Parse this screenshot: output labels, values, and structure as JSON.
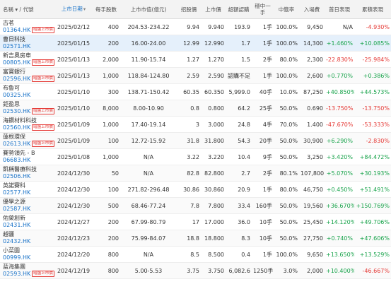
{
  "columns": {
    "name": "名稱 ▾ / 代號",
    "list_date": "上市日期",
    "lot": "每手股數",
    "mcap": "上市市值(億元)",
    "offer_price": "招股價",
    "list_price": "上市價",
    "oversub": "超額認購",
    "win_lot": "穩中一手",
    "win_rate": "中籤率",
    "entry_fee": "入場費",
    "day1": "首日表現",
    "cumulative": "累積表現"
  },
  "sorted_column": "list_date",
  "rows": [
    {
      "name": "古茗",
      "code": "01364.HK",
      "badge": "暗盤上市價",
      "date": "2025/02/12",
      "lot": "400",
      "mcap": "204.53-234.22",
      "offer": "9.94",
      "list": "9.940",
      "oversub": "193.9",
      "win": "1手",
      "rate": "100.0%",
      "fee": "9,450",
      "day1": "N/A",
      "cum": "-4.930%",
      "highlight": false
    },
    {
      "name": "曹日科技",
      "code": "02571.HK",
      "badge": "",
      "date": "2025/01/15",
      "lot": "200",
      "mcap": "16.00-24.00",
      "offer": "12.99",
      "list": "12.990",
      "oversub": "1.7",
      "win": "1手",
      "rate": "100.0%",
      "fee": "14,300",
      "day1": "+1.460%",
      "cum": "+10.085%",
      "highlight": true
    },
    {
      "name": "新吉奧房車",
      "code": "00805.HK",
      "badge": "暗盤上市價",
      "date": "2025/01/13",
      "lot": "2,000",
      "mcap": "11.90-15.74",
      "offer": "1.27",
      "list": "1.270",
      "oversub": "1.5",
      "win": "2手",
      "rate": "80.0%",
      "fee": "2,300",
      "day1": "-22.830%",
      "cum": "-25.984%",
      "highlight": false
    },
    {
      "name": "富寶銀行",
      "code": "02596.HK",
      "badge": "暗盤上市價",
      "date": "2025/01/13",
      "lot": "1,000",
      "mcap": "118.84-124.80",
      "offer": "2.59",
      "list": "2.590",
      "oversub": "認購不足",
      "win": "1手",
      "rate": "100.0%",
      "fee": "2,600",
      "day1": "+0.770%",
      "cum": "+0.386%",
      "highlight": false
    },
    {
      "name": "布魯可",
      "code": "00325.HK",
      "badge": "",
      "date": "2025/01/10",
      "lot": "300",
      "mcap": "138.71-150.42",
      "offer": "60.35",
      "list": "60.350",
      "oversub": "5,999.0",
      "win": "40手",
      "rate": "10.0%",
      "fee": "87,250",
      "day1": "+40.850%",
      "cum": "+44.573%",
      "highlight": false
    },
    {
      "name": "鉅盈思",
      "code": "02530.HK",
      "badge": "暗盤上市價",
      "date": "2025/01/10",
      "lot": "8,000",
      "mcap": "8.00-10.90",
      "offer": "0.8",
      "list": "0.800",
      "oversub": "64.2",
      "win": "25手",
      "rate": "50.0%",
      "fee": "0.690",
      "day1": "-13.750%",
      "cum": "-13.750%",
      "highlight": false
    },
    {
      "name": "海鑽材料科技",
      "code": "02560.HK",
      "badge": "暗盤上市價",
      "date": "2025/01/09",
      "lot": "1,000",
      "mcap": "17.40-19.14",
      "offer": "3",
      "list": "3.000",
      "oversub": "24.8",
      "win": "4手",
      "rate": "70.0%",
      "fee": "1.400",
      "day1": "-47.670%",
      "cum": "-53.333%",
      "highlight": false
    },
    {
      "name": "蓮根環保",
      "code": "02613.HK",
      "badge": "暗盤上市價",
      "date": "2025/01/09",
      "lot": "100",
      "mcap": "12.72-15.92",
      "offer": "31.8",
      "list": "31.800",
      "oversub": "54.3",
      "win": "20手",
      "rate": "50.0%",
      "fee": "30,900",
      "day1": "+6.290%",
      "cum": "-2.830%",
      "highlight": false
    },
    {
      "name": "賽勢領先 - B",
      "code": "06683.HK",
      "badge": "",
      "date": "2025/01/08",
      "lot": "1,000",
      "mcap": "N/A",
      "offer": "3.22",
      "list": "3.220",
      "oversub": "10.4",
      "win": "9手",
      "rate": "50.0%",
      "fee": "3,250",
      "day1": "+3.420%",
      "cum": "+84.472%",
      "highlight": false
    },
    {
      "name": "凱稱醫療科技",
      "code": "02506.HK",
      "badge": "",
      "date": "2024/12/30",
      "lot": "50",
      "mcap": "N/A",
      "offer": "82.8",
      "list": "82.800",
      "oversub": "2.7",
      "win": "2手",
      "rate": "80.1%",
      "fee": "107,800",
      "day1": "+5.070%",
      "cum": "+30.193%",
      "highlight": false
    },
    {
      "name": "英諾賽科",
      "code": "02577.HK",
      "badge": "",
      "date": "2024/12/30",
      "lot": "100",
      "mcap": "271.82-296.48",
      "offer": "30.86",
      "list": "30.860",
      "oversub": "20.9",
      "win": "1手",
      "rate": "80.0%",
      "fee": "46,750",
      "day1": "+0.450%",
      "cum": "+51.491%",
      "highlight": false
    },
    {
      "name": "優學之源",
      "code": "02587.HK",
      "badge": "",
      "date": "2024/12/30",
      "lot": "500",
      "mcap": "68.46-77.24",
      "offer": "7.8",
      "list": "7.800",
      "oversub": "33.4",
      "win": "160手",
      "rate": "50.0%",
      "fee": "19,560",
      "day1": "+36.670%",
      "cum": "+150.769%",
      "highlight": false
    },
    {
      "name": "佑榮創新",
      "code": "02431.HK",
      "badge": "",
      "date": "2024/12/27",
      "lot": "200",
      "mcap": "67.99-80.79",
      "offer": "17",
      "list": "17.000",
      "oversub": "36.0",
      "win": "10手",
      "rate": "50.0%",
      "fee": "25,450",
      "day1": "+14.120%",
      "cum": "+49.706%",
      "highlight": false
    },
    {
      "name": "越疆",
      "code": "02432.HK",
      "badge": "",
      "date": "2024/12/23",
      "lot": "200",
      "mcap": "75.99-84.07",
      "offer": "18.8",
      "list": "18.800",
      "oversub": "8.3",
      "win": "10手",
      "rate": "50.0%",
      "fee": "27,750",
      "day1": "+0.740%",
      "cum": "+47.606%",
      "highlight": false
    },
    {
      "name": "小菜園",
      "code": "00999.HK",
      "badge": "",
      "date": "2024/12/20",
      "lot": "800",
      "mcap": "N/A",
      "offer": "8.5",
      "list": "8.500",
      "oversub": "0.4",
      "win": "1手",
      "rate": "100.0%",
      "fee": "9,650",
      "day1": "+13.650%",
      "cum": "+13.529%",
      "highlight": false
    },
    {
      "name": "蓝海集團",
      "code": "02593.HK",
      "badge": "暗盤上市價",
      "date": "2024/12/19",
      "lot": "800",
      "mcap": "5.00-5.53",
      "offer": "3.75",
      "list": "3.750",
      "oversub": "6,082.6",
      "win": "1250手",
      "rate": "3.0%",
      "fee": "2,000",
      "day1": "+10.400%",
      "cum": "-46.667%",
      "highlight": false
    }
  ]
}
